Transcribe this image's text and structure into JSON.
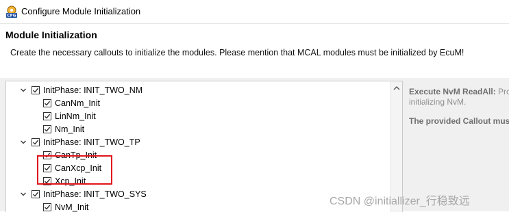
{
  "window": {
    "title": "Configure Module Initialization",
    "icon": "cfg-app-icon"
  },
  "header": {
    "title": "Module Initialization",
    "description": "Create the necessary callouts to initialize the modules. Please mention that MCAL modules must be initialized by EcuM!"
  },
  "tree": [
    {
      "label": "InitPhase: INIT_TWO_NM",
      "checked": true,
      "expanded": true,
      "children": [
        {
          "label": "CanNm_Init",
          "checked": true
        },
        {
          "label": "LinNm_Init",
          "checked": true
        },
        {
          "label": "Nm_Init",
          "checked": true
        }
      ]
    },
    {
      "label": "InitPhase: INIT_TWO_TP",
      "checked": true,
      "expanded": true,
      "children": [
        {
          "label": "CanTp_Init",
          "checked": true
        },
        {
          "label": "CanXcp_Init",
          "checked": true
        },
        {
          "label": "Xcp_Init",
          "checked": true
        }
      ]
    },
    {
      "label": "InitPhase: INIT_TWO_SYS",
      "checked": true,
      "expanded": true,
      "children": [
        {
          "label": "NvM_Init",
          "checked": true
        }
      ]
    }
  ],
  "details": {
    "line1_bold": "Execute NvM ReadAll:",
    "line1_rest": " Pro",
    "line2": "initializing NvM.",
    "line3": "The provided Callout mus"
  },
  "watermark": "CSDN @initiallizer_行稳致远"
}
